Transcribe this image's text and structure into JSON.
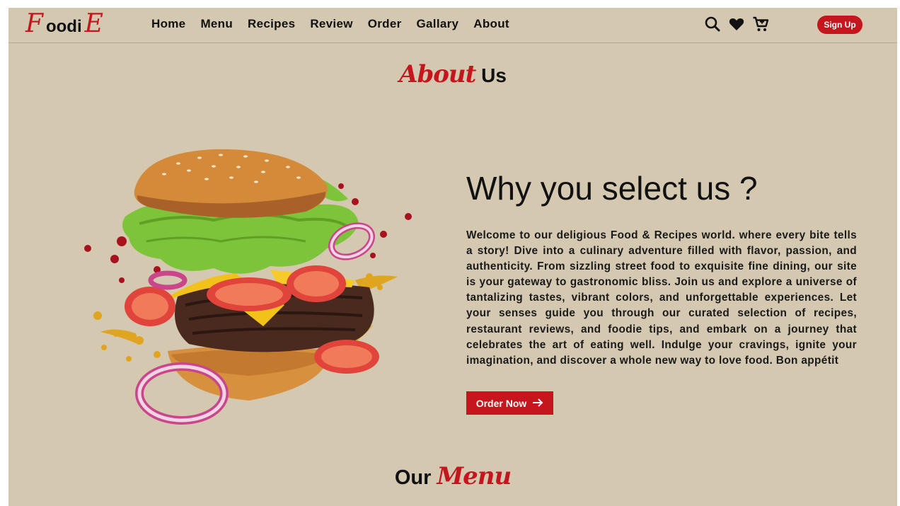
{
  "brand": {
    "logo_first": "F",
    "logo_middle": "oodi",
    "logo_last": "E",
    "accent": "#c4161c"
  },
  "nav": {
    "links": [
      "Home",
      "Menu",
      "Recipes",
      "Review",
      "Order",
      "Gallary",
      "About"
    ],
    "icons": [
      "search-icon",
      "heart-icon",
      "cart-icon"
    ],
    "signup_label": "Sign Up"
  },
  "about": {
    "heading_script": "About",
    "heading_plain": "Us",
    "title": "Why you select us ?",
    "description": "Welcome to our deligious Food & Recipes world. where every bite tells a story! Dive into a culinary adventure filled with flavor, passion, and authenticity. From sizzling street food to exquisite fine dining, our site is your gateway to gastronomic bliss. Join us and explore a universe of tantalizing tastes, vibrant colors, and unforgettable experiences. Let your senses guide you through our curated selection of recipes, restaurant reviews, and foodie tips, and embark on a journey that celebrates the art of eating well. Indulge your cravings, ignite your imagination, and discover a whole new way to love food. Bon appétit",
    "order_label": "Order Now"
  },
  "menu_section": {
    "heading_plain": "Our",
    "heading_script": "Menu"
  },
  "colors": {
    "background": "#d4c8b0",
    "accent": "#c4161c"
  }
}
